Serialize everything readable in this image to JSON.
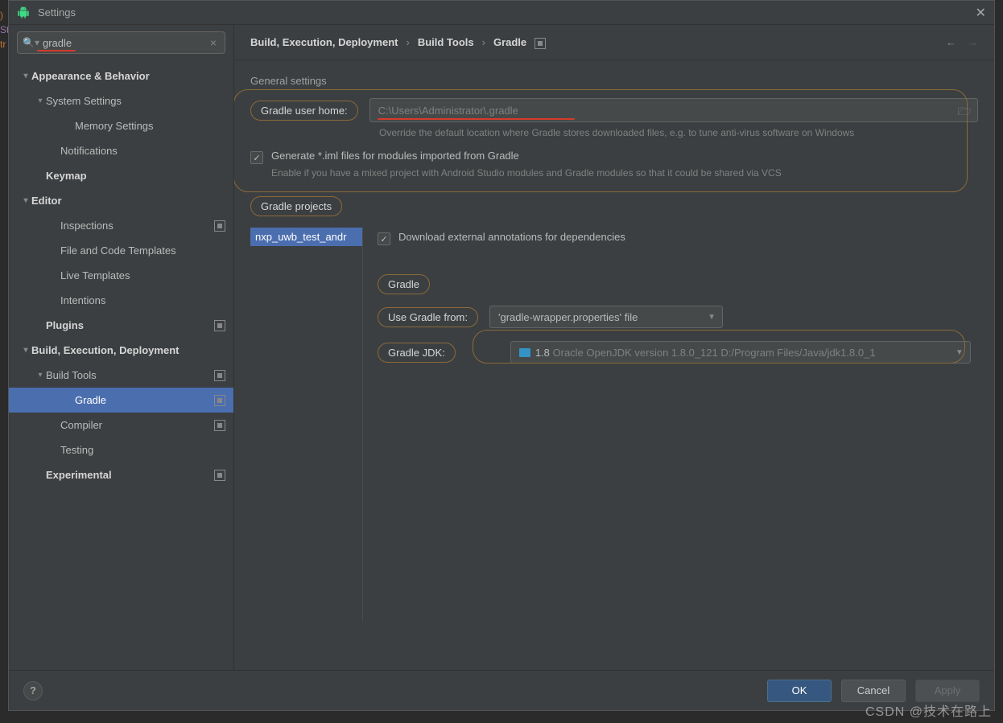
{
  "window": {
    "title": "Settings"
  },
  "search": {
    "value": "gradle"
  },
  "tree": {
    "appearance": "Appearance & Behavior",
    "system_settings": "System Settings",
    "memory_settings": "Memory Settings",
    "notifications": "Notifications",
    "keymap": "Keymap",
    "editor": "Editor",
    "inspections": "Inspections",
    "file_code_templates": "File and Code Templates",
    "live_templates": "Live Templates",
    "intentions": "Intentions",
    "plugins": "Plugins",
    "build": "Build, Execution, Deployment",
    "build_tools": "Build Tools",
    "gradle": "Gradle",
    "compiler": "Compiler",
    "testing": "Testing",
    "experimental": "Experimental"
  },
  "breadcrumb": {
    "b1": "Build, Execution, Deployment",
    "b2": "Build Tools",
    "b3": "Gradle"
  },
  "general": {
    "section": "General settings",
    "user_home_label": "Gradle user home:",
    "user_home_placeholder": "C:\\Users\\Administrator\\.gradle",
    "user_home_hint": "Override the default location where Gradle stores downloaded files, e.g. to tune anti-virus software on Windows",
    "iml_label": "Generate *.iml files for modules imported from Gradle",
    "iml_hint": "Enable if you have a mixed project with Android Studio modules and Gradle modules so that it could be shared via VCS"
  },
  "projects": {
    "section": "Gradle projects",
    "item": "nxp_uwb_test_andr",
    "download_label": "Download external annotations for dependencies",
    "gradle_section": "Gradle",
    "use_from_label": "Use Gradle from:",
    "use_from_value": "'gradle-wrapper.properties' file",
    "jdk_label": "Gradle JDK:",
    "jdk_version": "1.8",
    "jdk_detail": "Oracle OpenJDK version 1.8.0_121 D:/Program Files/Java/jdk1.8.0_1"
  },
  "footer": {
    "ok": "OK",
    "cancel": "Cancel",
    "apply": "Apply"
  },
  "watermark": "CSDN @技术在路上"
}
